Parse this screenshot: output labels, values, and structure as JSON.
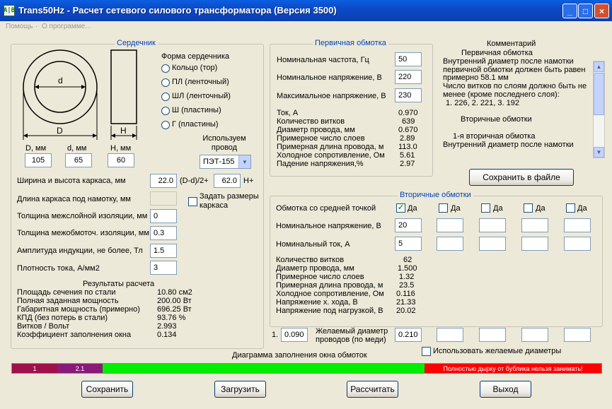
{
  "window": {
    "title": "Trans50Hz - Расчет сетевого силового трансформатора (Версия 3500)",
    "app_icon": "A|B",
    "minimize": "_",
    "maximize": "□",
    "close": "×"
  },
  "menu": {
    "help": "Помощь",
    "about": "О программе..."
  },
  "core": {
    "legend": "Сердечник",
    "d_inner_label": "d",
    "d_outer_label": "D",
    "h_label": "H",
    "shape_title": "Форма сердечника",
    "shapes": [
      "Кольцо  (тор)",
      "ПЛ  (ленточный)",
      "ШЛ  (ленточный)",
      "Ш  (пластины)",
      "Г  (пластины)"
    ],
    "selected_shape": 0,
    "dims_labels": [
      "D, мм",
      "d, мм",
      "H, мм"
    ],
    "dims_values": [
      "105",
      "65",
      "60"
    ],
    "wire_title": "Используем провод",
    "wire_value": "ПЭТ-155",
    "frame_label": "Ширина и высота каркаса, мм",
    "frame_width": "22.0",
    "frame_formula": "(D-d)/2+",
    "frame_height": "62.0",
    "frame_suffix": "H+",
    "frame_length_label": "Длина каркаса под намотку, мм",
    "frame_length_value": "",
    "set_frame_label": "Задать размеры каркаса",
    "interlayer_label": "Толщина межслойной изоляции, мм",
    "interlayer_value": "0",
    "interwinding_label": "Толщина межобмоточ. изоляции, мм",
    "interwinding_value": "0.3",
    "induction_label": "Амплитуда индукции, не более, Тл",
    "induction_value": "1.5",
    "current_density_label": "Плотность тока, А/мм2",
    "current_density_value": "3"
  },
  "results": {
    "title": "Результаты расчета",
    "rows": [
      {
        "label": "Площадь сечения по стали",
        "value": "10.80 см2"
      },
      {
        "label": "Полная заданная мощность",
        "value": "200.00 Вт"
      },
      {
        "label": "Габаритная мощность (примерно)",
        "value": "696.25 Вт"
      },
      {
        "label": "КПД (без потерь в стали)",
        "value": "93.76 %"
      },
      {
        "label": "Витков / Вольт",
        "value": "2.993"
      },
      {
        "label": "Коэффициент заполнения окна",
        "value": "0.134"
      }
    ]
  },
  "primary": {
    "legend": "Первичная обмотка",
    "freq_label": "Номинальная частота, Гц",
    "freq_value": "50",
    "volt_label": "Номинальное напряжение, В",
    "volt_value": "220",
    "maxvolt_label": "Максимальное напряжение, В",
    "maxvolt_value": "230",
    "rows": [
      {
        "label": "Ток, А",
        "value": "0.970"
      },
      {
        "label": "Количество витков",
        "value": "639"
      },
      {
        "label": "Диаметр провода, мм",
        "value": "0.670"
      },
      {
        "label": "Примерное число слоев",
        "value": "2.89"
      },
      {
        "label": "Примерная длина провода, м",
        "value": "113.0"
      },
      {
        "label": "Холодное сопротивление, Ом",
        "value": "5.61"
      },
      {
        "label": "Падение напряжения,%",
        "value": "2.97"
      }
    ]
  },
  "comment": {
    "title": "Комментарий",
    "lines": [
      "Первичная обмотка",
      "Внутренний диаметр после намотки",
      "первичной обмотки должен быть равен",
      "примерно 58.1 мм",
      "Число витков по слоям должно быть не",
      "менее (кроме последнего слоя):",
      "1. 226,  2. 221,  3. 192",
      "",
      "Вторичные обмотки",
      "",
      "1-я вторичная обмотка",
      "Внутренний диаметр после намотки"
    ],
    "save_button": "Сохранить в файле"
  },
  "secondary": {
    "legend": "Вторичные обмотки",
    "center_tap_label": "Обмотка со средней точкой",
    "checkbox_label": "Да",
    "checked": [
      true,
      false,
      false,
      false,
      false
    ],
    "volt_label": "Номинальное напряжение, В",
    "volt_values": [
      "20",
      "",
      "",
      "",
      ""
    ],
    "current_label": "Номинальный ток, А",
    "current_values": [
      "5",
      "",
      "",
      "",
      ""
    ],
    "rows": [
      {
        "label": "Количество витков",
        "value": "62"
      },
      {
        "label": "Диаметр провода, мм",
        "value": "1.500"
      },
      {
        "label": "Примерное число слоев",
        "value": "1.32"
      },
      {
        "label": "Примерная длина провода, м",
        "value": "23.5"
      },
      {
        "label": "Холодное сопротивление, Ом",
        "value": "0.116"
      },
      {
        "label": "Напряжение х. хода, В",
        "value": "21.33"
      },
      {
        "label": "Напряжение под нагрузкой, В",
        "value": "20.02"
      }
    ],
    "primary_wish_prefix": "1.",
    "primary_wish_value": "0.090",
    "wish_label": "Желаемый диаметр проводов  (по меди)",
    "wish_values": [
      "0.210",
      "",
      "",
      "",
      ""
    ],
    "use_wish_label": "Использовать желаемые диаметры"
  },
  "fill_diagram": {
    "title": "Диаграмма заполнения окна обмоток",
    "segments": [
      {
        "label": "1",
        "color": "#a0104a",
        "fraction": 0.077
      },
      {
        "label": "2.1",
        "color": "#8a1a7a",
        "fraction": 0.077
      },
      {
        "label": "",
        "color": "#00ee00",
        "fraction": 0.546
      },
      {
        "label": "Полностью дырку от бублика нельзя занимать!",
        "color": "#ff0000",
        "fraction": 0.3
      }
    ]
  },
  "buttons": {
    "save": "Сохранить",
    "load": "Загрузить",
    "calculate": "Рассчитать",
    "exit": "Выход"
  }
}
